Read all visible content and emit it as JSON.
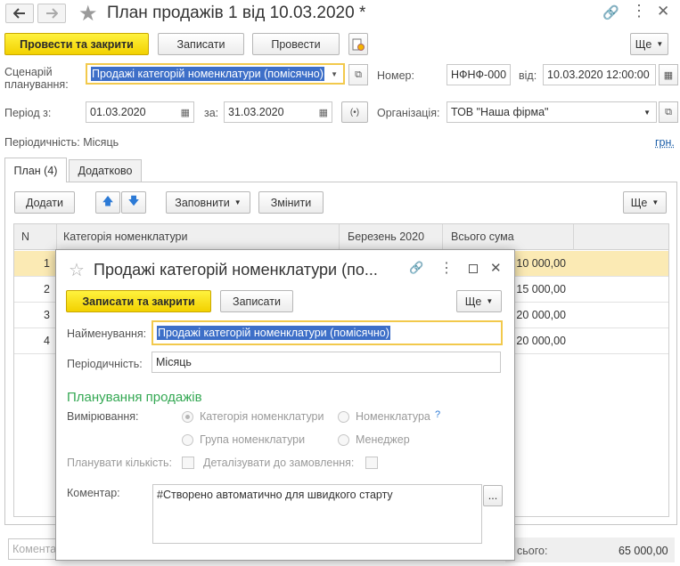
{
  "window": {
    "title": "План продажів 1 від 10.03.2020 *"
  },
  "toolbar": {
    "post_close": "Провести та закрити",
    "write": "Записати",
    "post": "Провести",
    "more": "Ще"
  },
  "header": {
    "scenario_label": "Сценарій планування:",
    "scenario_value": "Продажі категорій номенклатури (помісячно)",
    "number_label": "Номер:",
    "number_value": "НФНФ-000",
    "from_label": "від:",
    "date_value": "10.03.2020 12:00:00",
    "period_label": "Період з:",
    "period_from": "01.03.2020",
    "to_label": "за:",
    "period_to": "31.03.2020",
    "org_label": "Організація:",
    "org_value": "ТОВ \"Наша фірма\"",
    "periodicity_text": "Періодичність: Місяць",
    "currency": "грн."
  },
  "tabs": [
    {
      "label": "План (4)"
    },
    {
      "label": "Додатково"
    }
  ],
  "table_toolbar": {
    "add": "Додати",
    "fill": "Заповнити",
    "change": "Змінити",
    "more": "Ще"
  },
  "table": {
    "columns": [
      "N",
      "Категорія номенклатури",
      "Березень 2020",
      "Всього сума"
    ],
    "rows": [
      {
        "n": "1",
        "sum": "10 000,00"
      },
      {
        "n": "2",
        "sum": "15 000,00"
      },
      {
        "n": "3",
        "sum": "20 000,00"
      },
      {
        "n": "4",
        "sum": "20 000,00"
      }
    ]
  },
  "footer": {
    "comment_placeholder": "Комента",
    "total_label": "сього:",
    "total_value": "65 000,00"
  },
  "dialog": {
    "title": "Продажі категорій номенклатури (по...",
    "write_close": "Записати та закрити",
    "write": "Записати",
    "more": "Ще",
    "name_label": "Найменування:",
    "name_value": "Продажі категорій номенклатури (помісячно)",
    "periodicity_label": "Періодичність:",
    "periodicity_value": "Місяць",
    "section_title": "Планування продажів",
    "measure_label": "Вимірювання:",
    "opt_category": "Категорія номенклатури",
    "opt_nomenclature": "Номенклатура",
    "help": "?",
    "opt_group": "Група номенклатури",
    "opt_manager": "Менеджер",
    "plan_qty_label": "Планувати кількість:",
    "detail_label": "Деталізувати до замовлення:",
    "comment_label": "Коментар:",
    "comment_value": "#Створено автоматично для швидкого старту",
    "dots": "..."
  }
}
